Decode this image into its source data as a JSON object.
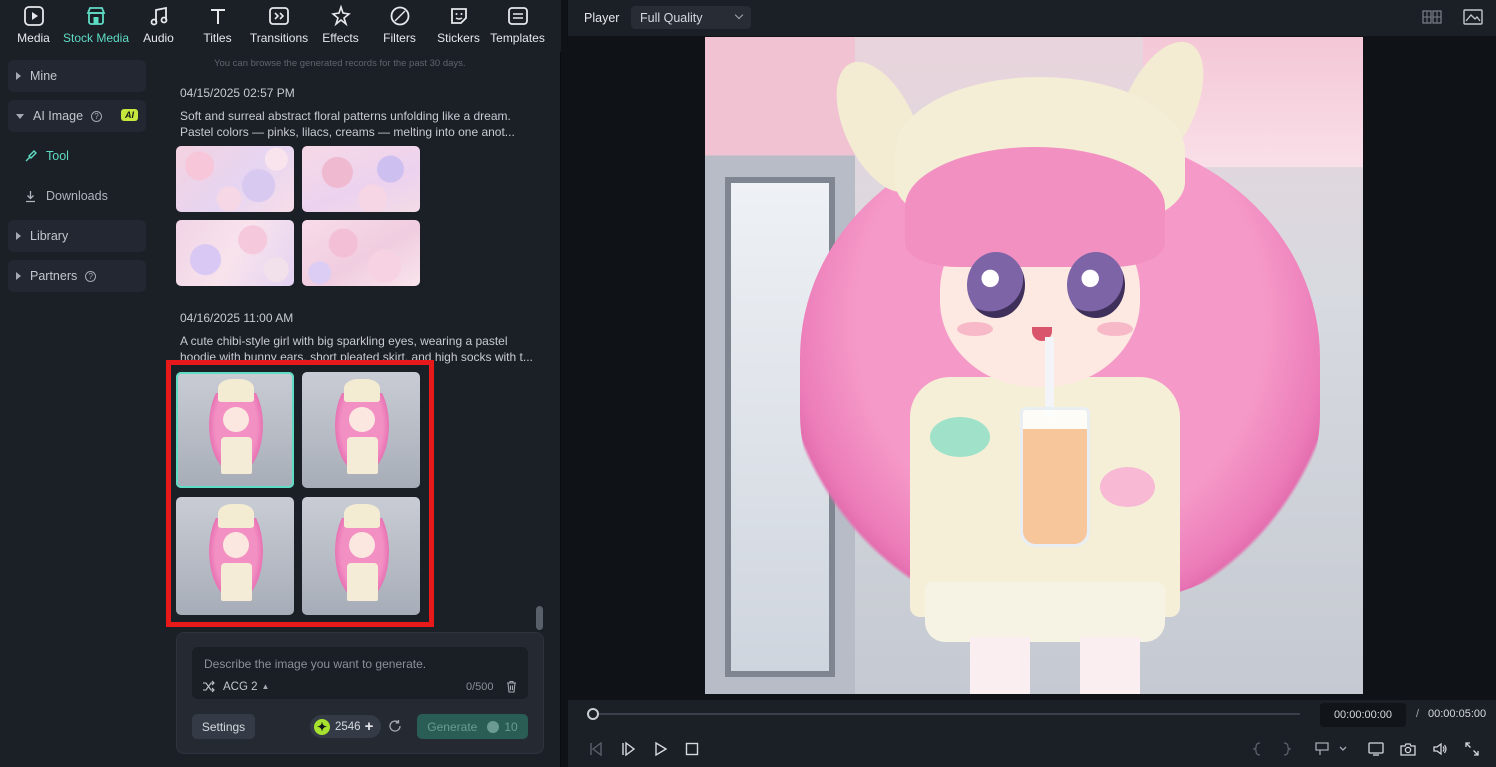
{
  "toolbar": {
    "tabs": [
      {
        "label": "Media",
        "icon": "media-icon"
      },
      {
        "label": "Stock Media",
        "icon": "stock-media-icon",
        "active": true
      },
      {
        "label": "Audio",
        "icon": "audio-icon"
      },
      {
        "label": "Titles",
        "icon": "titles-icon"
      },
      {
        "label": "Transitions",
        "icon": "transitions-icon"
      },
      {
        "label": "Effects",
        "icon": "effects-icon"
      },
      {
        "label": "Filters",
        "icon": "filters-icon"
      },
      {
        "label": "Stickers",
        "icon": "stickers-icon"
      },
      {
        "label": "Templates",
        "icon": "templates-icon"
      }
    ],
    "accent": "#5fdcc4"
  },
  "sidebar": {
    "mine": "Mine",
    "ai_image": "AI Image",
    "ai_badge": "AI",
    "tool": "Tool",
    "downloads": "Downloads",
    "library": "Library",
    "partners": "Partners"
  },
  "records": {
    "note": "You can browse the generated records for the past 30 days.",
    "items": [
      {
        "date": "04/15/2025 02:57 PM",
        "prompt": "Soft and surreal abstract floral patterns unfolding like a dream. Pastel colors — pinks, lilacs, creams — melting into one anot..."
      },
      {
        "date": "04/16/2025 11:00 AM",
        "prompt": "A cute chibi-style girl with big sparkling eyes, wearing a pastel hoodie with bunny ears, short pleated skirt, and high socks with t..."
      }
    ]
  },
  "generator": {
    "placeholder": "Describe the image you want to generate.",
    "model": "ACG 2",
    "count": "0/500",
    "settings_label": "Settings",
    "credits": "2546",
    "generate_label": "Generate",
    "generate_cost": "10"
  },
  "player": {
    "label": "Player",
    "quality": "Full Quality",
    "current_time": "00:00:00:00",
    "separator": "/",
    "total_time": "00:00:05:00",
    "progress": 0
  },
  "colors": {
    "highlight": "#e8191b",
    "coin": "#a6e22e",
    "ai_badge": "#c6e83c"
  }
}
